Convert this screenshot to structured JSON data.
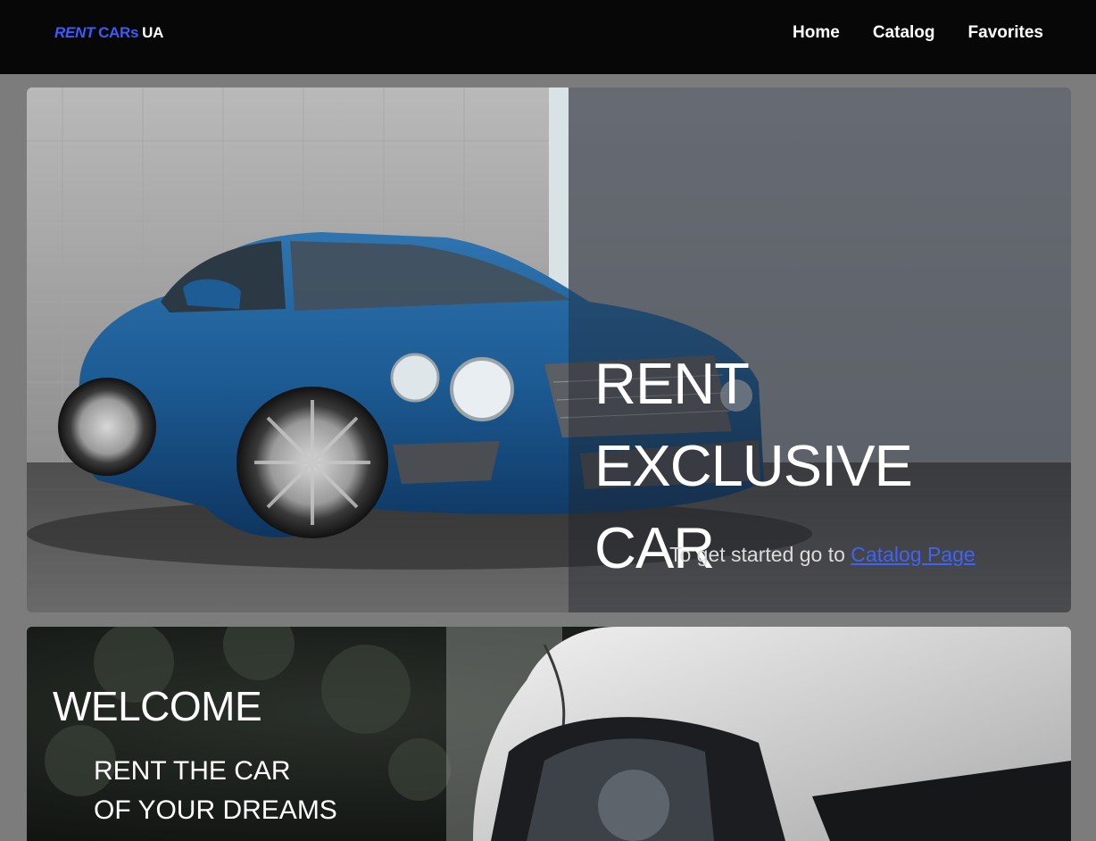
{
  "header": {
    "logo": {
      "part1": "RENT",
      "part2": "CARs",
      "part3": "UA"
    },
    "nav": [
      {
        "label": "Home"
      },
      {
        "label": "Catalog"
      },
      {
        "label": "Favorites"
      }
    ]
  },
  "hero": {
    "title_line1": "RENT EXCLUSIVE",
    "title_line2": "CAR",
    "subtitle_prefix": "To get started go to ",
    "subtitle_link": "Catalog Page",
    "image": "blue-luxury-coupe-photo"
  },
  "welcome": {
    "title": "WELCOME",
    "line1": "RENT THE CAR",
    "line2": "OF YOUR DREAMS",
    "image": "silver-car-headlight-photo"
  },
  "colors": {
    "accent": "#3b5bff",
    "link": "#3e63f5",
    "header_bg": "#070707",
    "page_bg": "#7c7c7c"
  }
}
